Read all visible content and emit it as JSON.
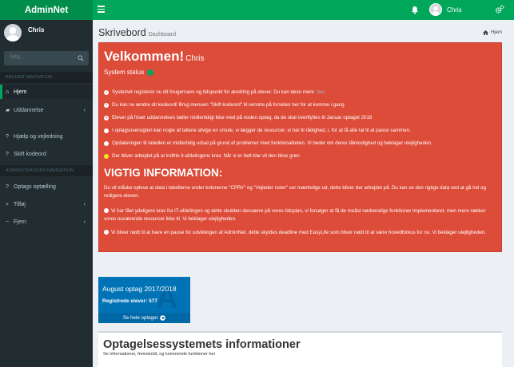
{
  "app": {
    "name": "AdminNet"
  },
  "topbar": {
    "user_name": "Chris"
  },
  "sidebar": {
    "user_name": "Chris",
    "search_placeholder": "Søg...",
    "header_main": "BRUGER NAVIGATION",
    "header_admin": "ADMINISTRATIONS NAVIGATION",
    "items": [
      {
        "label": "Hjem",
        "icon": "home-icon"
      },
      {
        "label": "Uddannelse",
        "icon": "graduation-icon"
      },
      {
        "label": "Hjælp og vejledning",
        "icon": "question-icon"
      },
      {
        "label": "Skift kodeord",
        "icon": "question-icon"
      },
      {
        "label": "Optags optælling",
        "icon": "question-icon"
      },
      {
        "label": "Tilføj",
        "icon": "plus-icon"
      },
      {
        "label": "Fjern",
        "icon": "minus-icon"
      }
    ]
  },
  "page": {
    "title": "Skrivebord",
    "subtitle": "Dashboard",
    "breadcrumb": "Hjem"
  },
  "welcome": {
    "heading": "Velkommen!",
    "name": "Chris",
    "status_label": "System status",
    "status_color": "#00a65a",
    "bullets": [
      {
        "text": "Systemet registerer nu dit brugernavn og tidspunkt for ændring på elever. Du kan læse mere",
        "link": "her.",
        "mark": "check"
      },
      {
        "text": "Du kan nu ændre dit kodeord! Brug menuen \"Skift kodeord\" til venstre på forsiden her for at komme i gang.",
        "mark": "check"
      },
      {
        "text": "Elever på frisør uddannelsen tæller midlertidigt ikke med på noden optag, da de skal overflyttes til Januar optaget 2018",
        "mark": "arrow"
      },
      {
        "text": "I optagsoversigten kan nogle af tallene afvige en smule, vi lægger de resourcer, vi har til rådighed, i, for at få alle tal til at passe sammen.",
        "mark": "dot"
      },
      {
        "text": "Opdateringen til tabellen er midlertidig udsat på grund af problemer med funktionaliteten. Vi beder om deres tålmodighed og beklager ulejligheden.",
        "mark": "dot"
      },
      {
        "text": "Der bliver arbejdet på at indfrie it-afdelingens krav. Når vi er helt klar vil den blive grøn",
        "mark": "yellow"
      }
    ]
  },
  "important": {
    "heading": "VIGTIG INFORMATION:",
    "para1": "Du vil måske opleve at data i tabellerne under kolonerne \"CPR#\" og \"Vejleder noter\" ser mærkelige ud, dette bliver der arbejdet på. Du kan se den rigtige data ved at gå ind og redigere eleven.",
    "para2": "Vi har fået ydeligere krav fra IT-afdelingen og dette skubber desværre på vores tidsplan, vi forsøger at få de meåst nødvendige funktioner implementeret, men mere rækker vores nuværende resourcer ikke til. Vi beklager ulejligheden.",
    "para3": "Vi bliver nødt til at have en pause for udviklingen af AdminNet, dette skyldes deadline med EasyLife som bliver nødt til at være hovedforkus for nu. Vi beklager ulejligheden."
  },
  "stat_box": {
    "title": "August optag 2017/2018",
    "count_label": "Registrede elever: 577",
    "footer_label": "Se hele optaget",
    "color": "#0073b7"
  },
  "info_box": {
    "title": "Optagelsessystemets informationer",
    "subtitle": "Se informationer, fremskridt, og kommende funktioner her"
  }
}
